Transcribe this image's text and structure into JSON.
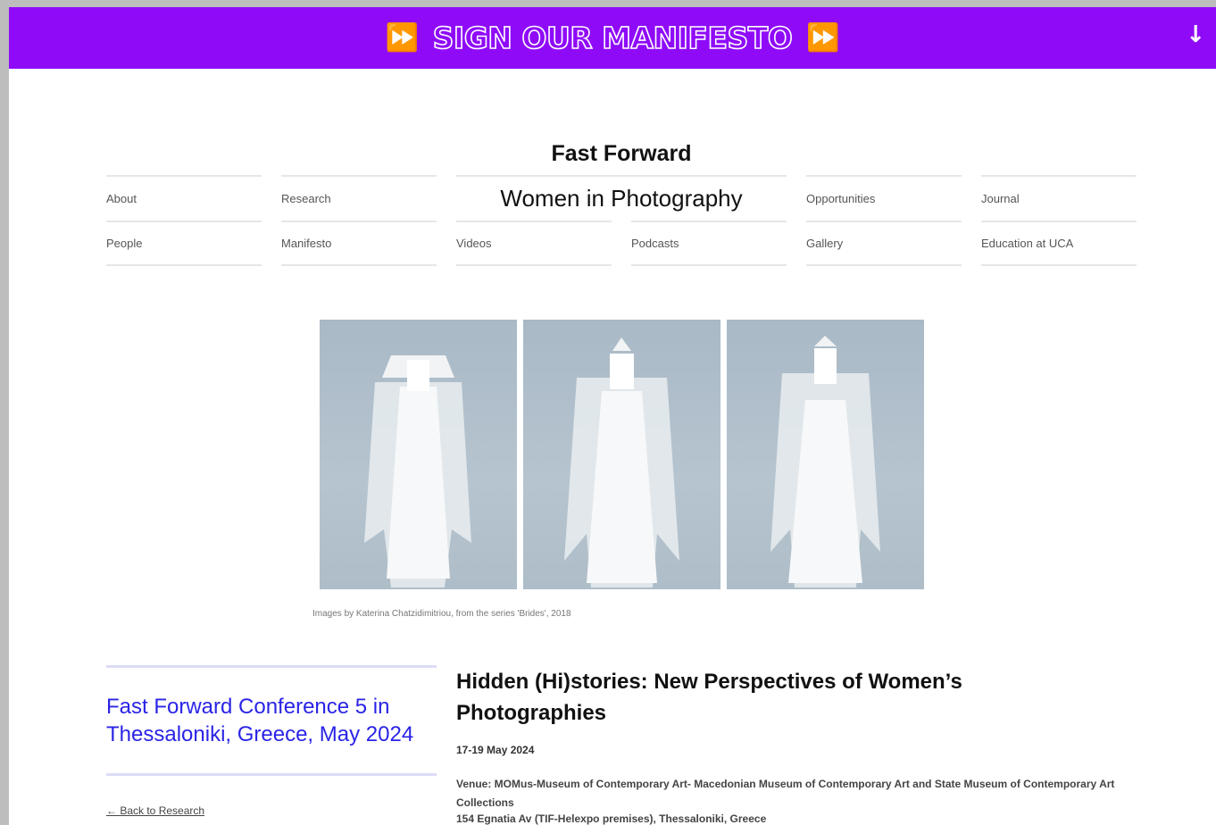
{
  "banner": {
    "text": "SIGN OUR MANIFESTO",
    "icon_left": "fast-forward-icon",
    "icon_right": "fast-forward-icon",
    "arrow": "↓",
    "color": "#8f0bf8"
  },
  "site": {
    "title": "Fast Forward",
    "subtitle": "Women in Photography"
  },
  "nav": {
    "row1": [
      "About",
      "Research",
      "Opportunities",
      "Journal"
    ],
    "row2": [
      "People",
      "Manifesto",
      "Videos",
      "Podcasts",
      "Gallery",
      "Education at UCA"
    ]
  },
  "gallery": {
    "caption": "Images by Katerina Chatzidimitriou, from the series 'Brides', 2018"
  },
  "sidebar": {
    "title": "Fast Forward Conference 5 in Thessaloniki, Greece, May 2024",
    "back_link": "← Back to Research",
    "accent": "#2a24e6"
  },
  "event": {
    "title": "Hidden (Hi)stories: New Perspectives of Women’s Photographies",
    "date": "17-19 May 2024",
    "venue": "Venue: MOMus-Museum of Contemporary Art- Macedonian Museum of Contemporary Art and State Museum of Contemporary Art Collections",
    "address": "154 Egnatia Av (TIF-Helexpo premises), Thessaloniki, Greece"
  }
}
